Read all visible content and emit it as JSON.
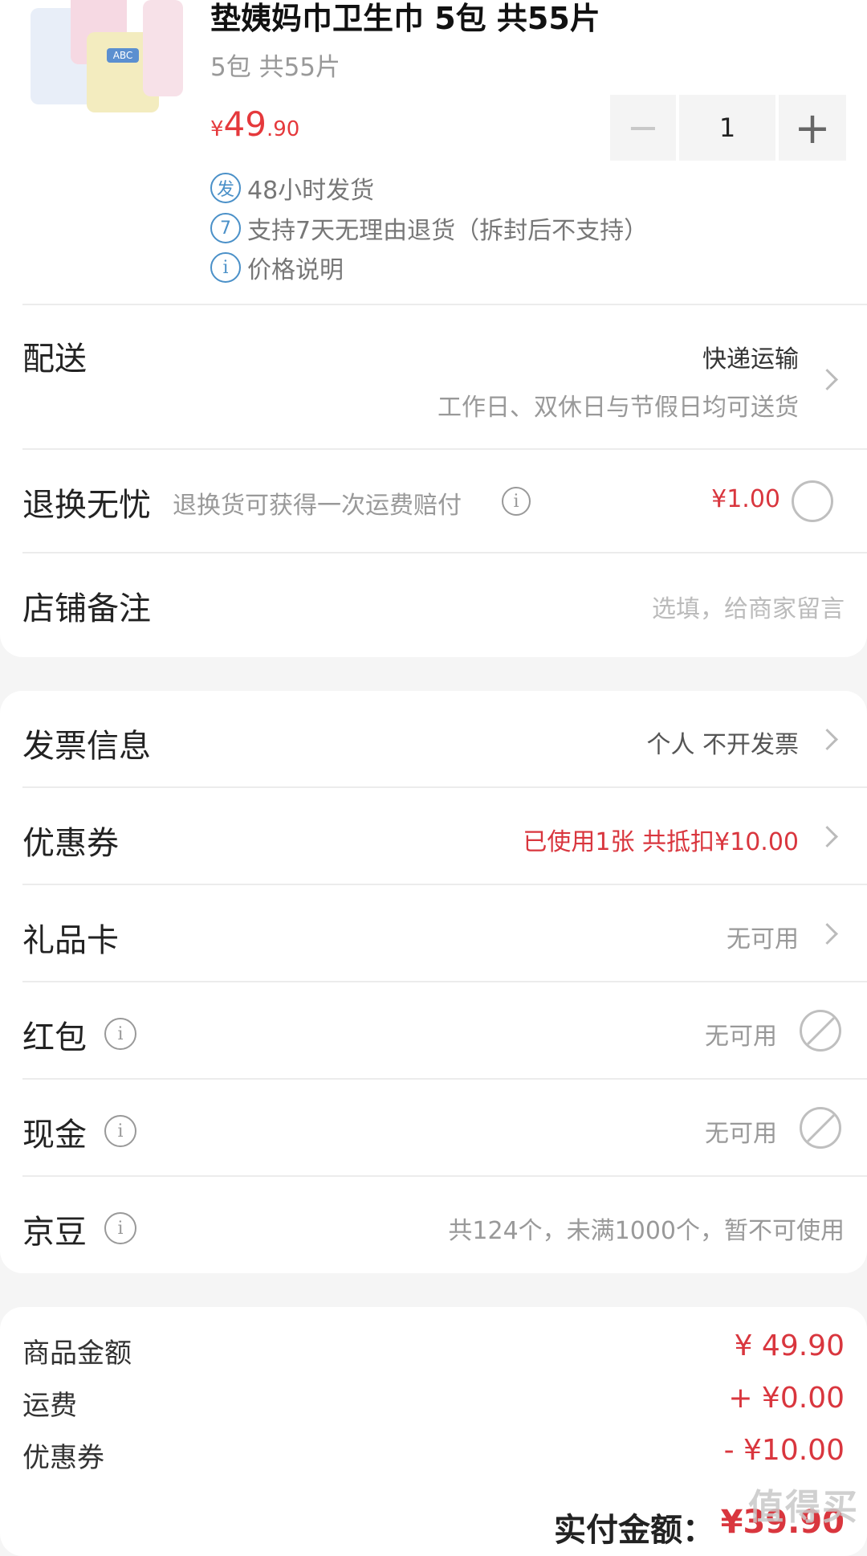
{
  "product": {
    "title": "垫姨妈巾卫生巾 5包 共55片",
    "spec": "5包 共55片",
    "price_currency": "¥",
    "price_int": "49",
    "price_dec": ".90",
    "quantity": "1",
    "minus": "−",
    "plus": "+",
    "services": [
      {
        "icon": "发",
        "text": "48小时发货"
      },
      {
        "icon": "7",
        "text": "支持7天无理由退货（拆封后不支持）"
      },
      {
        "icon": "i",
        "text": "价格说明"
      }
    ]
  },
  "delivery": {
    "label": "配送",
    "method": "快递运输",
    "note": "工作日、双休日与节假日均可送货"
  },
  "return_insurance": {
    "label": "退换无忧",
    "desc": "退换货可获得一次运费赔付",
    "price": "¥1.00"
  },
  "shop_note": {
    "label": "店铺备注",
    "placeholder": "选填，给商家留言"
  },
  "invoice": {
    "label": "发票信息",
    "value": "个人 不开发票"
  },
  "coupon": {
    "label": "优惠券",
    "value": "已使用1张 共抵扣¥10.00"
  },
  "gift_card": {
    "label": "礼品卡",
    "value": "无可用"
  },
  "red_packet": {
    "label": "红包",
    "value": "无可用"
  },
  "cash": {
    "label": "现金",
    "value": "无可用"
  },
  "jingdou": {
    "label": "京豆",
    "value": "共124个，未满1000个，暂不可使用"
  },
  "summary": {
    "goods_label": "商品金额",
    "goods_value": "¥ 49.90",
    "shipping_label": "运费",
    "shipping_value": "+ ¥0.00",
    "coupon_label": "优惠券",
    "coupon_value": "- ¥10.00",
    "pay_label": "实付金额：",
    "pay_value": "¥39.90"
  },
  "watermark": "值得买",
  "colors": {
    "accent_red": "#d9363e",
    "service_blue": "#4a90c8"
  }
}
